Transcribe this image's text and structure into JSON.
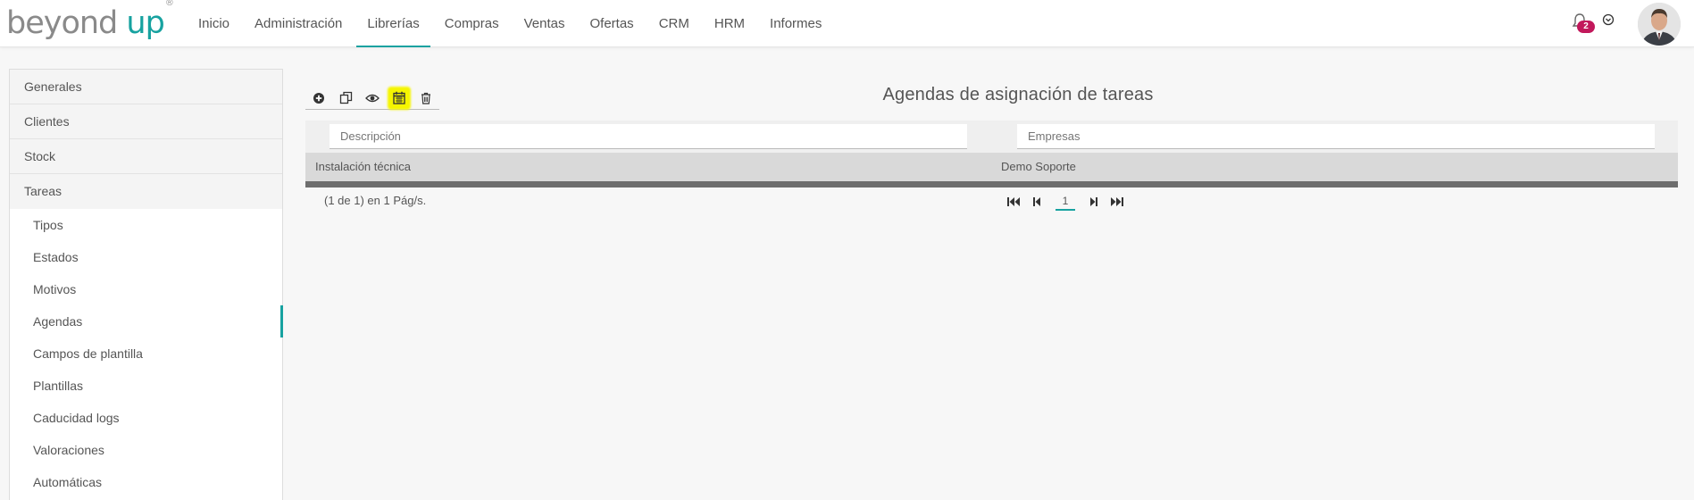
{
  "brand": {
    "word1": "beyond ",
    "word2": "up",
    "mark": "®"
  },
  "nav": [
    "Inicio",
    "Administración",
    "Librerías",
    "Compras",
    "Ventas",
    "Ofertas",
    "CRM",
    "HRM",
    "Informes"
  ],
  "nav_active": "Librerías",
  "notifications": {
    "count": "2"
  },
  "sidebar": {
    "sections": [
      "Generales",
      "Clientes",
      "Stock",
      "Tareas"
    ],
    "tareas_items": [
      "Tipos",
      "Estados",
      "Motivos",
      "Agendas",
      "Campos de plantilla",
      "Plantillas",
      "Caducidad logs",
      "Valoraciones",
      "Automáticas"
    ],
    "active_item": "Agendas"
  },
  "toolbar": {
    "buttons": [
      "plus-circle-icon",
      "copy-icon",
      "eye-icon",
      "calendar-icon",
      "trash-icon"
    ],
    "highlighted": "calendar-icon"
  },
  "page": {
    "title": "Agendas de asignación de tareas"
  },
  "filters": {
    "description_placeholder": "Descripción",
    "companies_placeholder": "Empresas"
  },
  "table": {
    "rows": [
      {
        "description": "Instalación técnica",
        "company": "Demo Soporte"
      }
    ]
  },
  "pager": {
    "info": "(1 de 1) en 1 Pág/s.",
    "current_page": "1"
  },
  "colors": {
    "accent": "#17a2a0",
    "badge": "#c2185b",
    "highlight": "#f5f500"
  }
}
